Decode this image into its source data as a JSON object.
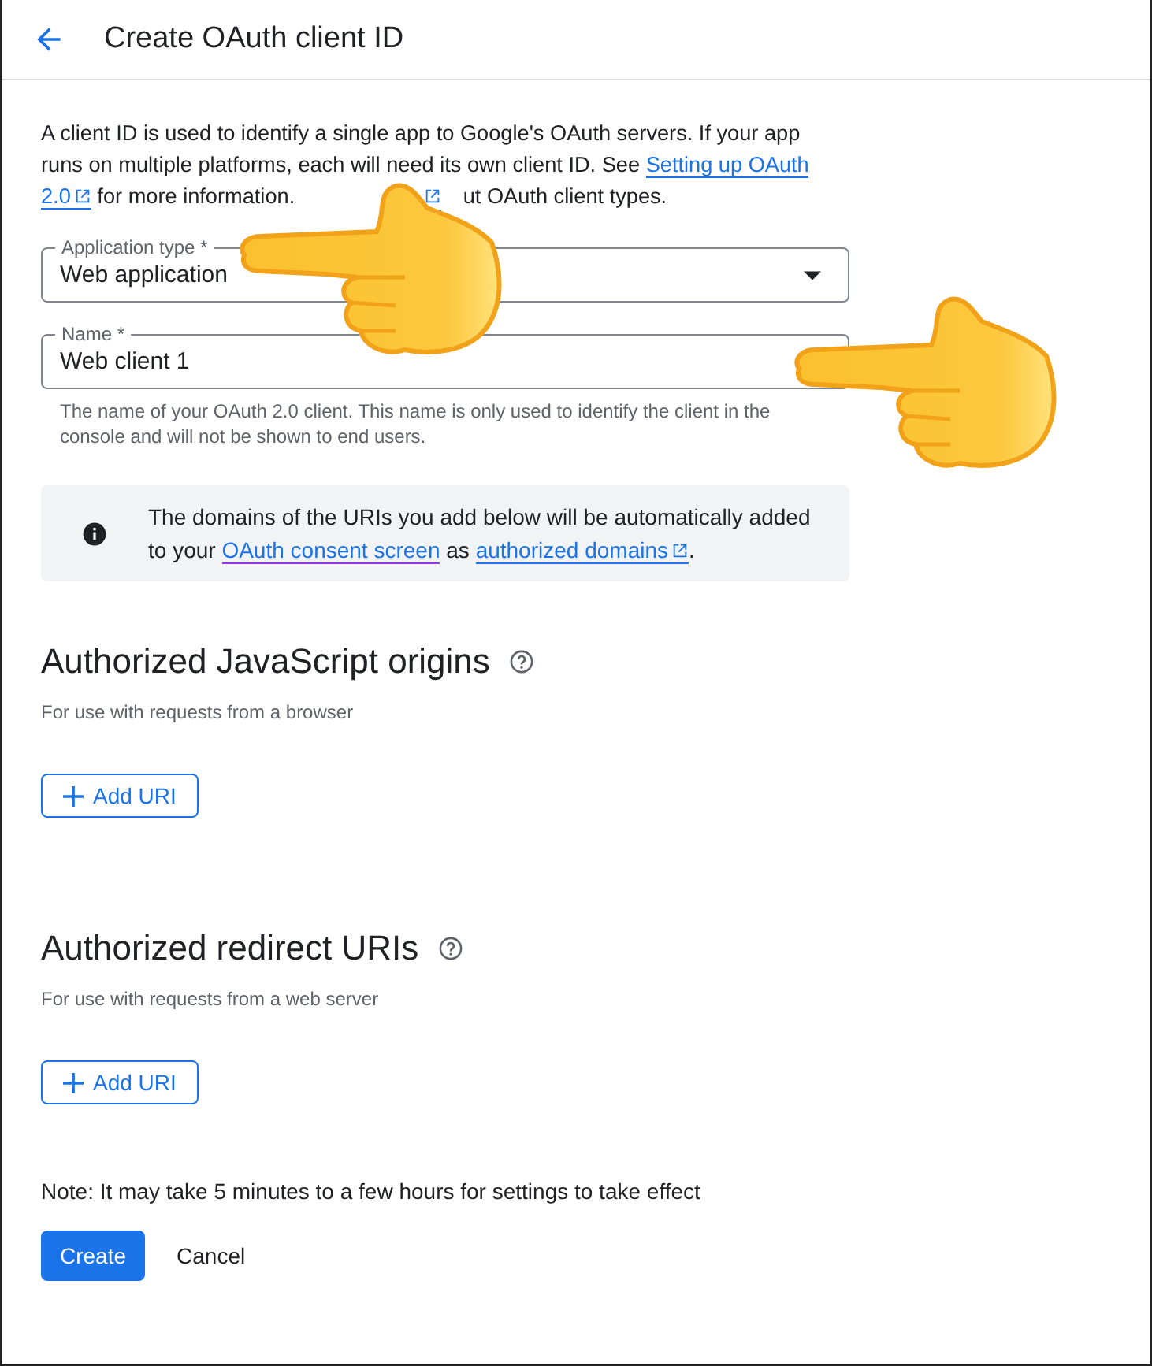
{
  "header": {
    "title": "Create OAuth client ID"
  },
  "intro": [
    {
      "kind": "text",
      "text": "A client ID is used to identify a single app to Google's OAuth servers. If your app runs on multiple platforms, each will need its own client ID. See "
    },
    {
      "kind": "link",
      "text": "Setting up OAuth",
      "external": false
    },
    {
      "kind": "link",
      "text": "2.0",
      "external": true
    },
    {
      "kind": "text",
      "text": " for more information."
    },
    {
      "kind": "covered-link",
      "external": true
    },
    {
      "kind": "text",
      "text": "ut OAuth client types."
    }
  ],
  "fields": [
    {
      "kind": "select",
      "label": "Application type *",
      "value": "Web application"
    },
    {
      "kind": "text",
      "label": "Name *",
      "value": "Web client 1",
      "hint": "The name of your OAuth 2.0 client. This name is only used to identify the client in the console and will not be shown to end users."
    }
  ],
  "notice": [
    {
      "kind": "text",
      "text": "The domains of the URIs you add below will be automatically added to your "
    },
    {
      "kind": "link",
      "text": "OAuth consent screen",
      "external": false,
      "visited": true
    },
    {
      "kind": "text",
      "text": " as "
    },
    {
      "kind": "link",
      "text": "authorized domains",
      "external": true
    },
    {
      "kind": "text",
      "text": "."
    }
  ],
  "sections": [
    {
      "title": "Authorized JavaScript origins",
      "subtitle": "For use with requests from a browser",
      "button": "Add URI"
    },
    {
      "title": "Authorized redirect URIs",
      "subtitle": "For use with requests from a web server",
      "button": "Add URI"
    }
  ],
  "note": "Note: It may take 5 minutes to a few hours for settings to take effect",
  "actions": [
    {
      "label": "Create",
      "kind": "primary"
    },
    {
      "label": "Cancel",
      "kind": "text"
    }
  ],
  "pointers": [
    {
      "kind": "pointing-hand"
    },
    {
      "kind": "pointing-hand"
    }
  ]
}
